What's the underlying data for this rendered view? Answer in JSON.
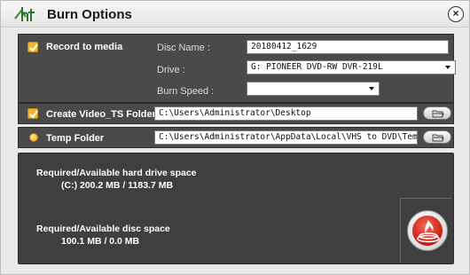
{
  "window": {
    "title": "Burn Options"
  },
  "record": {
    "label": "Record to media",
    "checked": true,
    "disc_name_label": "Disc Name :",
    "disc_name_value": "20180412_1629",
    "drive_label": "Drive :",
    "drive_value": "G: PIONEER  DVD-RW  DVR-219L",
    "burn_speed_label": "Burn Speed :",
    "burn_speed_value": ""
  },
  "video_ts": {
    "label": "Create Video_TS Folder",
    "checked": true,
    "path": "C:\\Users\\Administrator\\Desktop"
  },
  "temp": {
    "label": "Temp Folder",
    "selected": true,
    "path": "C:\\Users\\Administrator\\AppData\\Local\\VHS to DVD\\Temp\\"
  },
  "space": {
    "hdd_title": "Required/Available hard drive space",
    "hdd_value": "(C:)  200.2 MB / 1183.7 MB",
    "disc_title": "Required/Available disc space",
    "disc_value": "100.1 MB / 0.0 MB"
  },
  "icons": {
    "logo": "ht-logo-icon",
    "close": "close-icon",
    "browse": "folder-icon",
    "burn": "flame-disc-icon"
  },
  "colors": {
    "panel": "#4a4a4a",
    "accent": "#f2b432",
    "burn": "#c91a10"
  }
}
